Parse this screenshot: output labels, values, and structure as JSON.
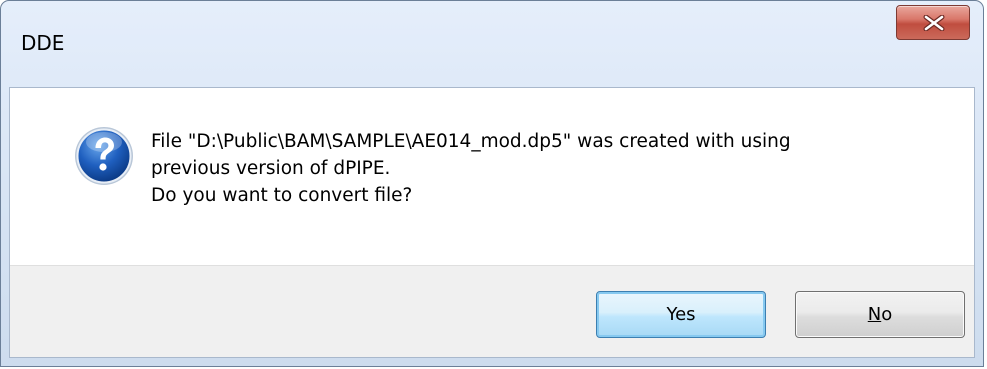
{
  "window": {
    "title": "DDE",
    "close_icon": "close-icon"
  },
  "dialog": {
    "icon": "question-icon",
    "message_lines": [
      "File \"D:\\Public\\BAM\\SAMPLE\\AE014_mod.dp5\" was created with using",
      "previous version of dPIPE.",
      "Do you want to convert file?"
    ]
  },
  "buttons": {
    "yes_label": "Yes",
    "no_first": "N",
    "no_rest": "o"
  }
}
